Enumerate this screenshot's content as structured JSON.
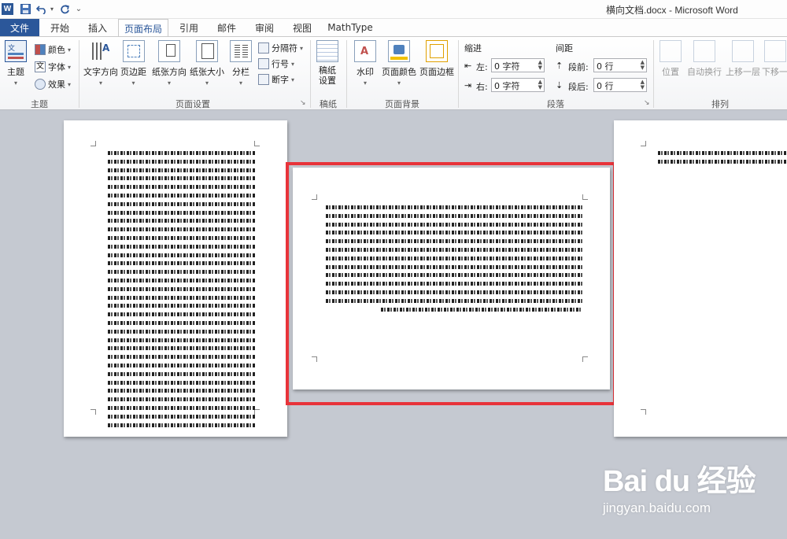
{
  "window": {
    "title": "横向文档.docx - Microsoft Word"
  },
  "quick_access": {
    "logo": "W",
    "save_icon": "save-icon",
    "undo_icon": "undo-icon",
    "redo_icon": "redo-icon",
    "more": "⌄"
  },
  "tabs": {
    "file": "文件",
    "items": [
      "开始",
      "插入",
      "页面布局",
      "引用",
      "邮件",
      "审阅",
      "视图",
      "MathType"
    ],
    "active": "页面布局"
  },
  "ribbon": {
    "theme_group": {
      "label": "主题",
      "theme": "主题",
      "colors": "颜色",
      "fonts": "字体",
      "effects": "效果"
    },
    "page_setup": {
      "label": "页面设置",
      "text_direction": "文字方向",
      "margins": "页边距",
      "orientation": "纸张方向",
      "size": "纸张大小",
      "columns": "分栏",
      "breaks": "分隔符",
      "line_numbers": "行号",
      "hyphenation": "断字"
    },
    "manuscript": {
      "label": "稿纸",
      "setup": "稿纸\n设置"
    },
    "background": {
      "label": "页面背景",
      "watermark": "水印",
      "page_color": "页面颜色",
      "page_borders": "页面边框"
    },
    "paragraph": {
      "label": "段落",
      "indent_title": "缩进",
      "spacing_title": "间距",
      "left_label": "左:",
      "left_value": "0 字符",
      "right_label": "右:",
      "right_value": "0 字符",
      "before_label": "段前:",
      "before_value": "0 行",
      "after_label": "段后:",
      "after_value": "0 行"
    },
    "arrange": {
      "label": "排列",
      "position": "位置",
      "wrap_text": "自动换行",
      "bring_forward": "上移一层",
      "send_backward": "下移一"
    }
  },
  "watermark": {
    "brand": "Bai du 经验",
    "url": "jingyan.baidu.com"
  },
  "colors": {
    "accent": "#2b579a",
    "highlight": "#e8333a",
    "doc_bg": "#c5c9d1"
  }
}
